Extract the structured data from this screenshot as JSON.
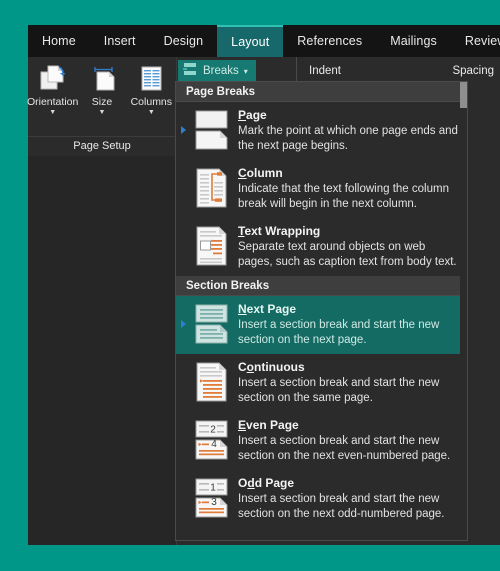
{
  "theme": {
    "desktop_background": "#009688",
    "window_background": "#141414",
    "ribbon_background": "#2b2b2b",
    "accent_teal": "#17686a",
    "selection_teal": "#146b63",
    "marker_blue": "#2f7fd1",
    "icon_orange": "#e07b39"
  },
  "ribbon": {
    "tabs": [
      {
        "label": "Home",
        "active": false
      },
      {
        "label": "Insert",
        "active": false
      },
      {
        "label": "Design",
        "active": false
      },
      {
        "label": "Layout",
        "active": true
      },
      {
        "label": "References",
        "active": false
      },
      {
        "label": "Mailings",
        "active": false
      },
      {
        "label": "Review",
        "active": false
      }
    ],
    "page_setup": {
      "group_title": "Page Setup",
      "buttons": [
        {
          "label": "Orientation",
          "icon": "orientation-icon",
          "caret": "▼"
        },
        {
          "label": "Size",
          "icon": "page-size-icon",
          "caret": "▼"
        },
        {
          "label": "Columns",
          "icon": "columns-icon",
          "caret": "▼"
        }
      ]
    },
    "breaks_button": {
      "label": "Breaks",
      "icon": "breaks-icon",
      "caret": "▾"
    },
    "right_labels": {
      "indent": "Indent",
      "spacing": "Spacing"
    }
  },
  "breaks_menu": {
    "sections": [
      {
        "header": "Page Breaks",
        "items": [
          {
            "title_prefix": "",
            "title_underline": "P",
            "title_suffix": "age",
            "title": "Page",
            "description": "Mark the point at which one page ends and the next page begins.",
            "icon": "page-break-icon",
            "selected": false,
            "marker": true
          },
          {
            "title_prefix": "",
            "title_underline": "C",
            "title_suffix": "olumn",
            "title": "Column",
            "description": "Indicate that the text following the column break will begin in the next column.",
            "icon": "column-break-icon",
            "selected": false,
            "marker": false
          },
          {
            "title_prefix": "",
            "title_underline": "T",
            "title_suffix": "ext Wrapping",
            "title": "Text Wrapping",
            "description": "Separate text around objects on web pages, such as caption text from body text.",
            "icon": "text-wrapping-icon",
            "selected": false,
            "marker": false
          }
        ]
      },
      {
        "header": "Section Breaks",
        "items": [
          {
            "title_prefix": "",
            "title_underline": "N",
            "title_suffix": "ext Page",
            "title": "Next Page",
            "description": "Insert a section break and start the new section on the next page.",
            "icon": "next-page-break-icon",
            "selected": true,
            "marker": true
          },
          {
            "title_prefix": "C",
            "title_underline": "o",
            "title_suffix": "ntinuous",
            "title": "Continuous",
            "description": "Insert a section break and start the new section on the same page.",
            "icon": "continuous-break-icon",
            "selected": false,
            "marker": false
          },
          {
            "title_prefix": "",
            "title_underline": "E",
            "title_suffix": "ven Page",
            "title": "Even Page",
            "description": "Insert a section break and start the new section on the next even-numbered page.",
            "icon": "even-page-break-icon",
            "selected": false,
            "marker": false,
            "icon_numbers": [
              "2",
              "4"
            ]
          },
          {
            "title_prefix": "O",
            "title_underline": "d",
            "title_suffix": "d Page",
            "title": "Odd Page",
            "description": "Insert a section break and start the new section on the next odd-numbered page.",
            "icon": "odd-page-break-icon",
            "selected": false,
            "marker": false,
            "icon_numbers": [
              "1",
              "3"
            ]
          }
        ]
      }
    ]
  }
}
